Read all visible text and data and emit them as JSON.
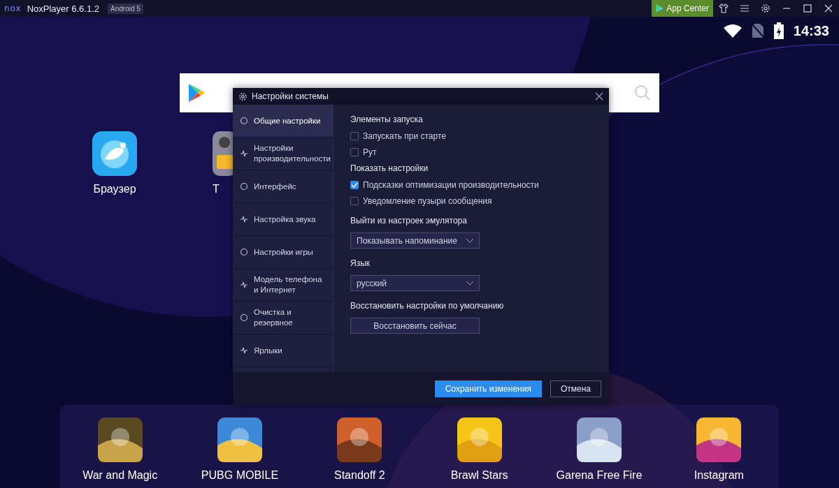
{
  "window": {
    "logo": "nox",
    "title": "NoxPlayer 6.6.1.2",
    "badge": "Android 5",
    "app_center": "App Center"
  },
  "status_bar": {
    "time": "14:33"
  },
  "desktop_apps": [
    {
      "label": "Браузер"
    },
    {
      "label": "T"
    }
  ],
  "dialog": {
    "title": "Настройки системы",
    "nav": [
      {
        "label": "Общие настройки",
        "selected": true
      },
      {
        "label": "Настройки производительности",
        "selected": false
      },
      {
        "label": "Интерфейс",
        "selected": false
      },
      {
        "label": "Настройка звука",
        "selected": false
      },
      {
        "label": "Настройки игры",
        "selected": false
      },
      {
        "label": "Модель телефона и Интернет",
        "selected": false
      },
      {
        "label": "Очистка и резервное",
        "selected": false
      },
      {
        "label": "Ярлыки",
        "selected": false
      }
    ],
    "sections": [
      {
        "kind": "checks",
        "heading": "Элементы запуска",
        "items": [
          {
            "label": "Запускать при старте",
            "checked": false
          },
          {
            "label": "Рут",
            "checked": false
          }
        ]
      },
      {
        "kind": "checks",
        "heading": "Показать настройки",
        "items": [
          {
            "label": "Подсказки оптимизации производительности",
            "checked": true
          },
          {
            "label": "Уведомление пузыри сообщения",
            "checked": false
          }
        ]
      },
      {
        "kind": "select",
        "heading": "Выйти из настроек эмулятора",
        "value": "Показывать напоминание"
      },
      {
        "kind": "select",
        "heading": "Язык",
        "value": "русский"
      },
      {
        "kind": "button",
        "heading": "Восстановить настройки по умолчанию",
        "button": "Восстановить сейчас"
      }
    ],
    "buttons": [
      {
        "label": "Сохранить изменения",
        "kind": "primary"
      },
      {
        "label": "Отмена",
        "kind": "secondary"
      }
    ]
  },
  "dock": [
    {
      "label": "War and Magic"
    },
    {
      "label": "PUBG MOBILE"
    },
    {
      "label": "Standoff 2"
    },
    {
      "label": "Brawl Stars"
    },
    {
      "label": "Garena Free Fire"
    },
    {
      "label": "Instagram"
    }
  ]
}
